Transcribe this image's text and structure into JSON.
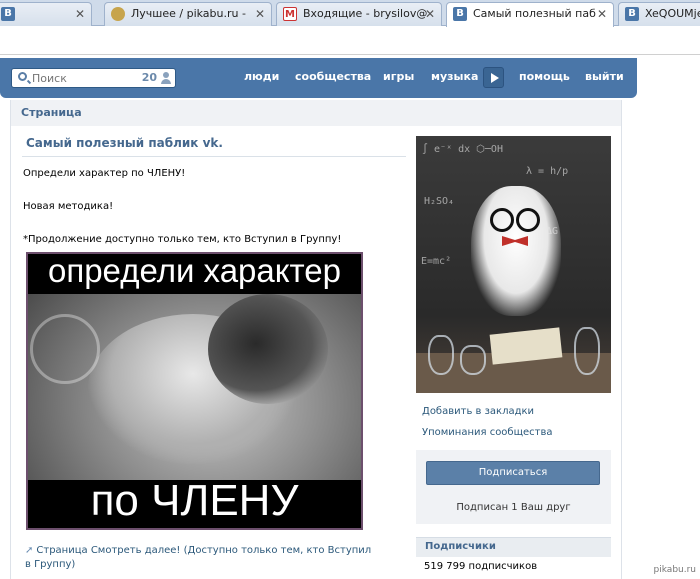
{
  "browser": {
    "tabs": [
      {
        "title": "",
        "icon": "vk-icon"
      },
      {
        "title": "Лучшее / pikabu.ru - ",
        "icon": "pikabu-icon"
      },
      {
        "title": "Входящие - brysilov@",
        "icon": "gmail-icon"
      },
      {
        "title": "Самый полезный паб",
        "icon": "vk-icon",
        "active": true
      },
      {
        "title": "XeQOUMje",
        "icon": "vk-icon"
      }
    ]
  },
  "header": {
    "search_placeholder": "Поиск",
    "search_count": "20",
    "nav": [
      "люди",
      "сообщества",
      "игры",
      "музыка",
      "помощь",
      "выйти"
    ],
    "accent": "#4a76a8"
  },
  "page": {
    "breadcrumb": "Страница",
    "title": "Самый полезный паблик vk.",
    "lines": [
      "Определи характер по ЧЛЕНУ!",
      "Новая методика!",
      "*Продолжение доступно только тем, кто Вступил в Группу!"
    ],
    "image_caption_top": "определи характер",
    "image_caption_bottom": "по ЧЛЕНУ",
    "more_link": "Страница Смотреть далее! (Доступно только тем, кто Вступил в Группу)"
  },
  "sidebar": {
    "links": [
      "Добавить в закладки",
      "Упоминания сообщества"
    ],
    "subscribe_label": "Подписаться",
    "friend_text": "Подписан 1 Ваш друг",
    "subscribers_header": "Подписчики",
    "subscribers_count": "519 799 подписчиков"
  },
  "watermark": "pikabu.ru"
}
